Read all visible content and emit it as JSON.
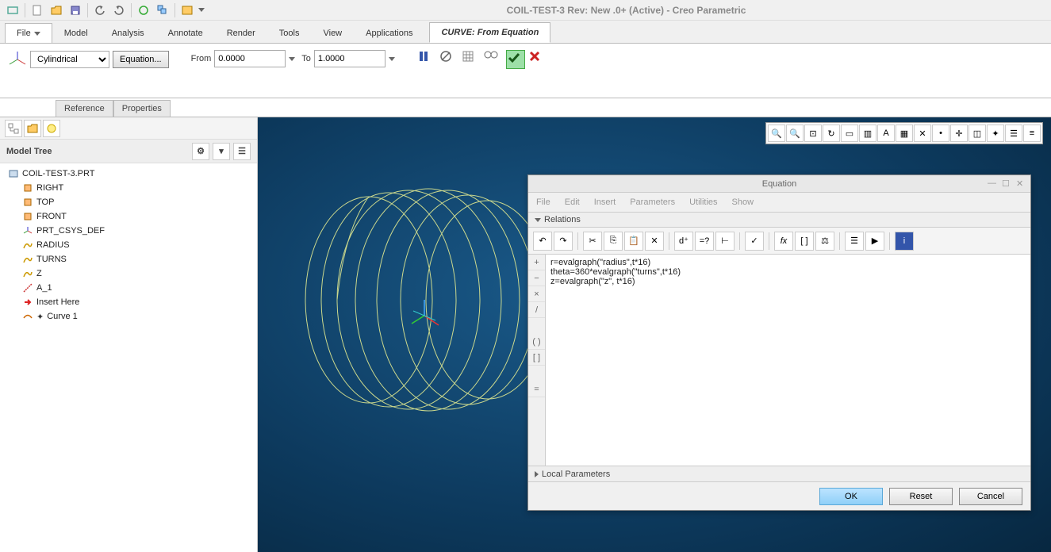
{
  "app_title": "COIL-TEST-3 Rev: New .0+  (Active) - Creo Parametric",
  "ribbon_tabs": {
    "file": "File",
    "model": "Model",
    "analysis": "Analysis",
    "annotate": "Annotate",
    "render": "Render",
    "tools": "Tools",
    "view": "View",
    "applications": "Applications",
    "context": "CURVE: From Equation"
  },
  "ribbon": {
    "csys_type": "Cylindrical",
    "equation_btn": "Equation...",
    "from_lbl": "From",
    "from_val": "0.0000",
    "to_lbl": "To",
    "to_val": "1.0000"
  },
  "subtabs": {
    "reference": "Reference",
    "properties": "Properties"
  },
  "tree": {
    "header": "Model Tree",
    "root": "COIL-TEST-3.PRT",
    "items": [
      "RIGHT",
      "TOP",
      "FRONT",
      "PRT_CSYS_DEF",
      "RADIUS",
      "TURNS",
      "Z",
      "A_1",
      "Insert Here",
      "Curve 1"
    ]
  },
  "dialog": {
    "title": "Equation",
    "menu": [
      "File",
      "Edit",
      "Insert",
      "Parameters",
      "Utilities",
      "Show"
    ],
    "relations_lbl": "Relations",
    "equations": "r=evalgraph(\"radius\",t*16)\ntheta=360*evalgraph(\"turns\",t*16)\nz=evalgraph(\"z\", t*16)",
    "local_params": "Local Parameters",
    "ok": "OK",
    "reset": "Reset",
    "cancel": "Cancel",
    "gutter": [
      "+",
      "−",
      "×",
      "/",
      "",
      "( )",
      "[ ]",
      "",
      "="
    ]
  }
}
